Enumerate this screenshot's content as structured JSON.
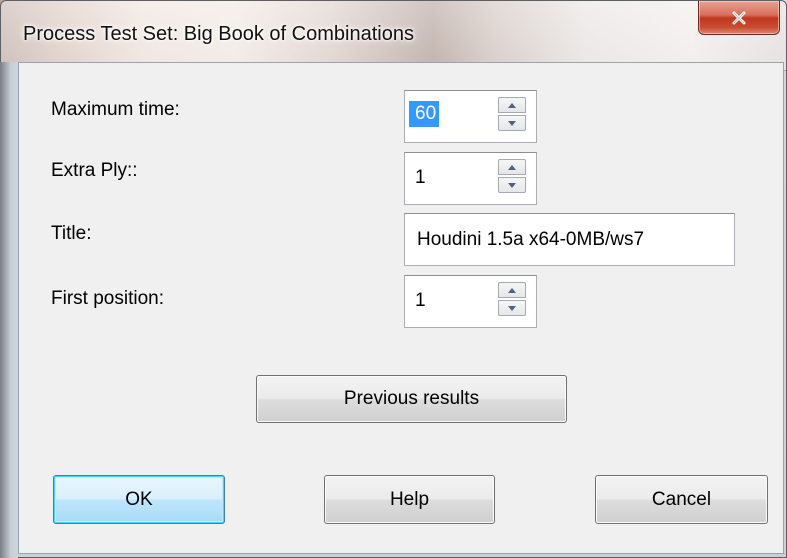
{
  "window": {
    "title": "Process Test Set: Big Book of Combinations",
    "close_symbol": "x"
  },
  "fields": {
    "max_time": {
      "label": "Maximum time:",
      "value": "60"
    },
    "extra_ply": {
      "label": "Extra Ply::",
      "value": "1"
    },
    "title": {
      "label": "Title:",
      "value": "Houdini 1.5a x64-0MB/ws7"
    },
    "first_position": {
      "label": "First position:",
      "value": "1"
    }
  },
  "buttons": {
    "previous_results": "Previous results",
    "ok": "OK",
    "help": "Help",
    "cancel": "Cancel"
  },
  "colors": {
    "selection": "#3399ff",
    "close_button": "#c1371e",
    "dialog_bg": "#f0f0f0"
  }
}
